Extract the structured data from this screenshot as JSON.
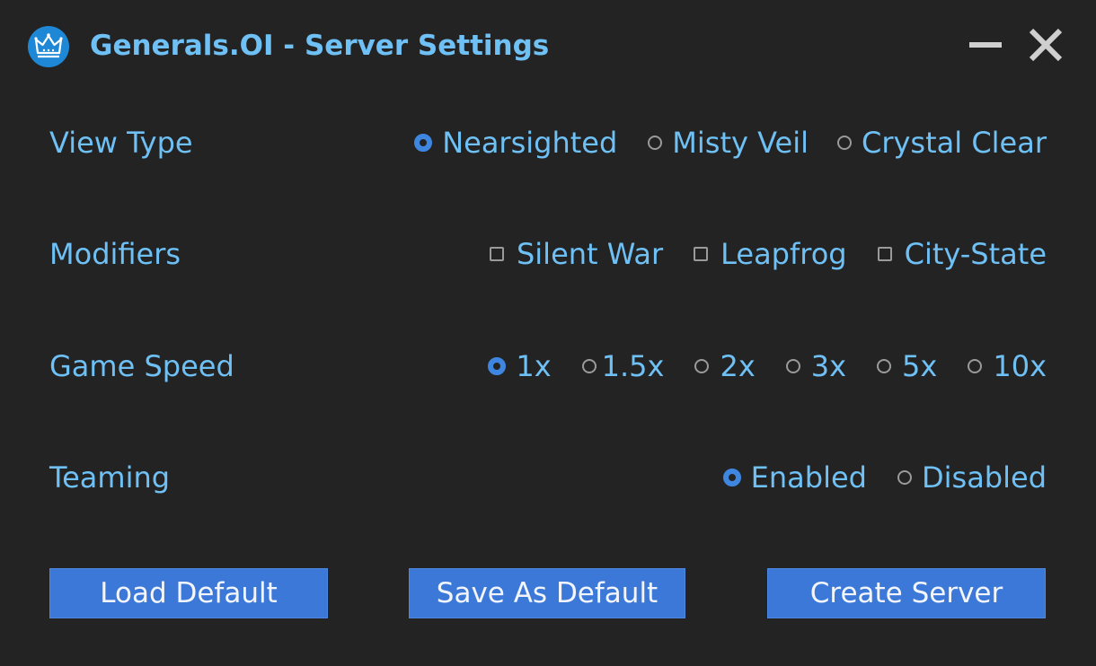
{
  "window": {
    "title": "Generals.OI - Server Settings",
    "logo_icon": "crown-icon",
    "minimize_icon": "minimize-icon",
    "close_icon": "close-icon"
  },
  "colors": {
    "background": "#232323",
    "text": "#6ec0f5",
    "accent": "#3c78d8",
    "radio_selected": "#3f86e0"
  },
  "settings": {
    "view_type": {
      "label": "View Type",
      "options": [
        "Nearsighted",
        "Misty Veil",
        "Crystal Clear"
      ],
      "selected": "Nearsighted"
    },
    "modifiers": {
      "label": "Modifiers",
      "options": [
        "Silent War",
        "Leapfrog",
        "City-State"
      ],
      "checked": []
    },
    "game_speed": {
      "label": "Game Speed",
      "options": [
        "1x",
        "1.5x",
        "2x",
        "3x",
        "5x",
        "10x"
      ],
      "selected": "1x"
    },
    "teaming": {
      "label": "Teaming",
      "options": [
        "Enabled",
        "Disabled"
      ],
      "selected": "Enabled"
    }
  },
  "buttons": {
    "load_default": "Load Default",
    "save_as_default": "Save As Default",
    "create_server": "Create Server"
  }
}
